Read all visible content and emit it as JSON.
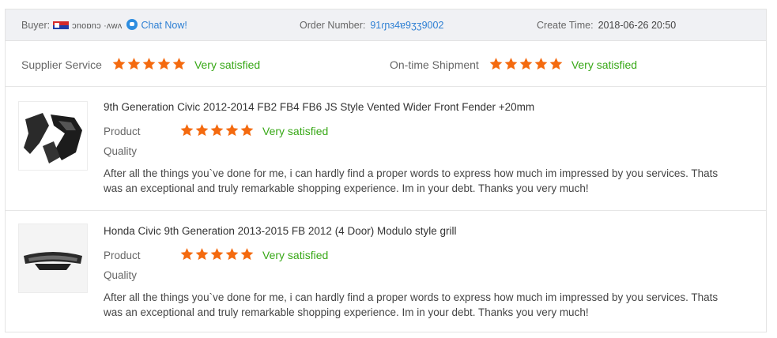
{
  "header": {
    "buyer_label": "Buyer:",
    "buyer_name": "ɔnoɒnɔ ·ʌwʌ",
    "chat_label": "Chat Now!",
    "order_label": "Order Number:",
    "order_value": "91ɾɲɜ4ɐ9ʒʒ9002",
    "create_label": "Create Time:",
    "create_value": "2018-06-26 20:50"
  },
  "ratings": {
    "supplier_label": "Supplier Service",
    "supplier_stars": 5,
    "supplier_text": "Very satisfied",
    "shipment_label": "On-time Shipment",
    "shipment_stars": 5,
    "shipment_text": "Very satisfied"
  },
  "products": [
    {
      "title": "9th Generation Civic 2012-2014 FB2 FB4 FB6 JS Style Vented Wider Front Fender +20mm",
      "product_label": "Product",
      "stars": 5,
      "satisfaction": "Very satisfied",
      "quality_label": "Quality",
      "review": "After all the things you`ve done for me, i can hardly find a proper words to express how much im impressed by you services. Thats was an exceptional and truly remarkable shopping experience. Im in your debt. Thanks you very much!",
      "image_icon": "fender-image"
    },
    {
      "title": "Honda Civic 9th Generation 2013-2015 FB 2012 (4 Door) Modulo style grill",
      "product_label": "Product",
      "stars": 5,
      "satisfaction": "Very satisfied",
      "quality_label": "Quality",
      "review": "After all the things you`ve done for me, i can hardly find a proper words to express how much im impressed by you services. Thats was an exceptional and truly remarkable shopping experience. Im in your debt. Thanks you very much!",
      "image_icon": "grill-image"
    }
  ],
  "colors": {
    "star": "#f46a0f",
    "satisfied": "#38a817",
    "link": "#2d7fd3",
    "header_bg": "#f0f1f4"
  }
}
